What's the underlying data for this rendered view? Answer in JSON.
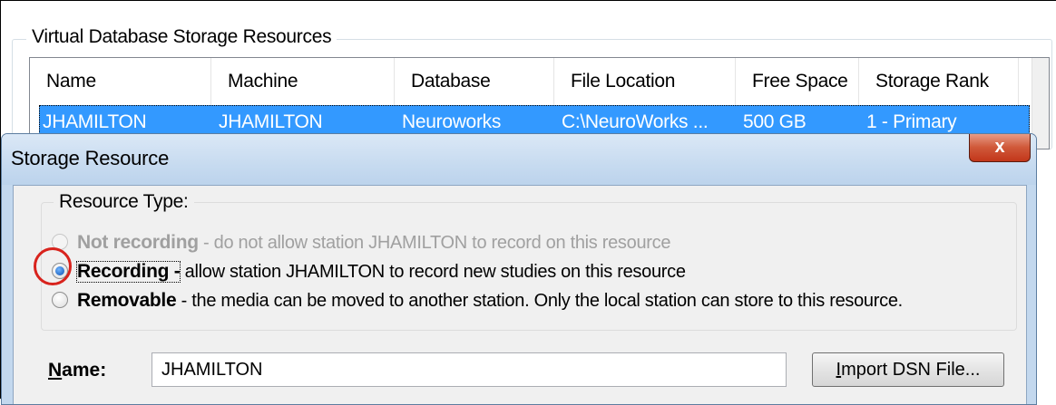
{
  "background": {
    "group_title": "Virtual Database Storage Resources",
    "columns": [
      "Name",
      "Machine",
      "Database",
      "File Location",
      "Free Space",
      "Storage Rank"
    ],
    "selected_row": [
      "JHAMILTON",
      "JHAMILTON",
      "Neuroworks",
      "C:\\NeuroWorks ...",
      "500 GB",
      "1 - Primary"
    ]
  },
  "dialog": {
    "title": "Storage Resource",
    "close_label": "x",
    "resource_type_label": "Resource Type:",
    "options": [
      {
        "title": "Not recording",
        "desc": " -  do not allow station JHAMILTON to record on this resource",
        "state": "disabled"
      },
      {
        "title": "Recording",
        "desc": " allow station JHAMILTON to record new studies on this resource",
        "state": "checked"
      },
      {
        "title": "Removable",
        "desc": " -  the media can be moved to another station.  Only the local station can store to this resource.",
        "state": "unchecked"
      }
    ],
    "name_label": "Name:",
    "name_value": "JHAMILTON",
    "import_button": "Import DSN File..."
  }
}
